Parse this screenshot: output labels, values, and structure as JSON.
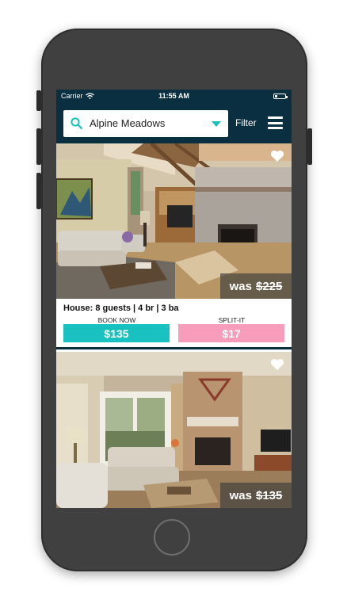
{
  "status_bar": {
    "carrier": "Carrier",
    "time": "11:55 AM"
  },
  "header": {
    "search_value": "Alpine Meadows",
    "filter_label": "Filter"
  },
  "listings": [
    {
      "type_label": "House:",
      "details": "8 guests | 4 br | 3 ba",
      "was_label": "was",
      "was_price": "$225",
      "book_label": "BOOK NOW",
      "book_price": "$135",
      "split_label": "SPLIT-IT",
      "split_price": "$17"
    },
    {
      "was_label": "was",
      "was_price": "$135"
    }
  ],
  "colors": {
    "header_bg": "#0a2f40",
    "book_button": "#19c2c0",
    "split_button": "#f79cbb"
  },
  "icons": [
    "search-icon",
    "dropdown-arrow-icon",
    "menu-icon",
    "heart-icon",
    "wifi-icon",
    "battery-icon"
  ]
}
